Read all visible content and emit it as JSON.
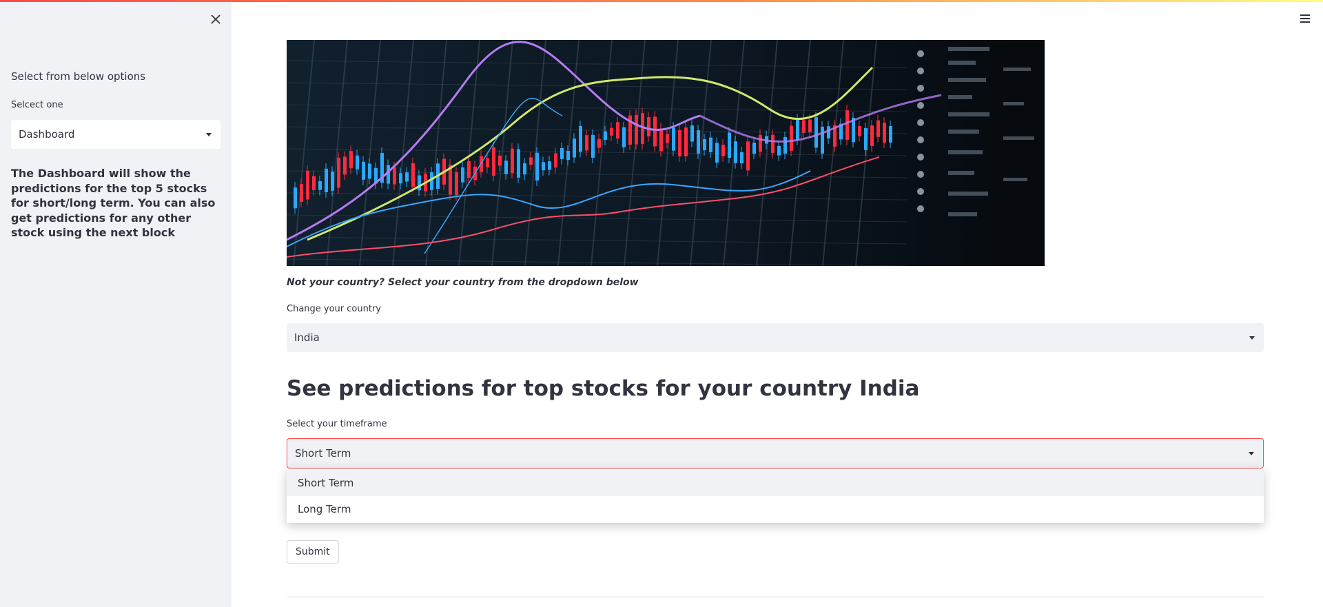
{
  "sidebar": {
    "header": "Select from below options",
    "select_label": "Selcect one",
    "select_value": "Dashboard",
    "description": "The Dashboard will show the predictions for the top 5 stocks for short/long term. You can also get predictions for any other stock using the next block",
    "close_icon": "close-icon"
  },
  "main": {
    "menu_icon": "hamburger-menu-icon",
    "banner": "stock-chart-banner",
    "country_note": "Not your country? Select your country from the dropdown below",
    "country_label": "Change your country",
    "country_value": "India",
    "heading": "See predictions for top stocks for your country India",
    "timeframe_label": "Select your timeframe",
    "timeframe_value": "Short Term",
    "timeframe_options": [
      "Short Term",
      "Long Term"
    ],
    "submit_label": "Submit"
  },
  "colors": {
    "accent": "#ff4b4b",
    "sidebar_bg": "#f0f2f6",
    "text": "#31333f"
  }
}
